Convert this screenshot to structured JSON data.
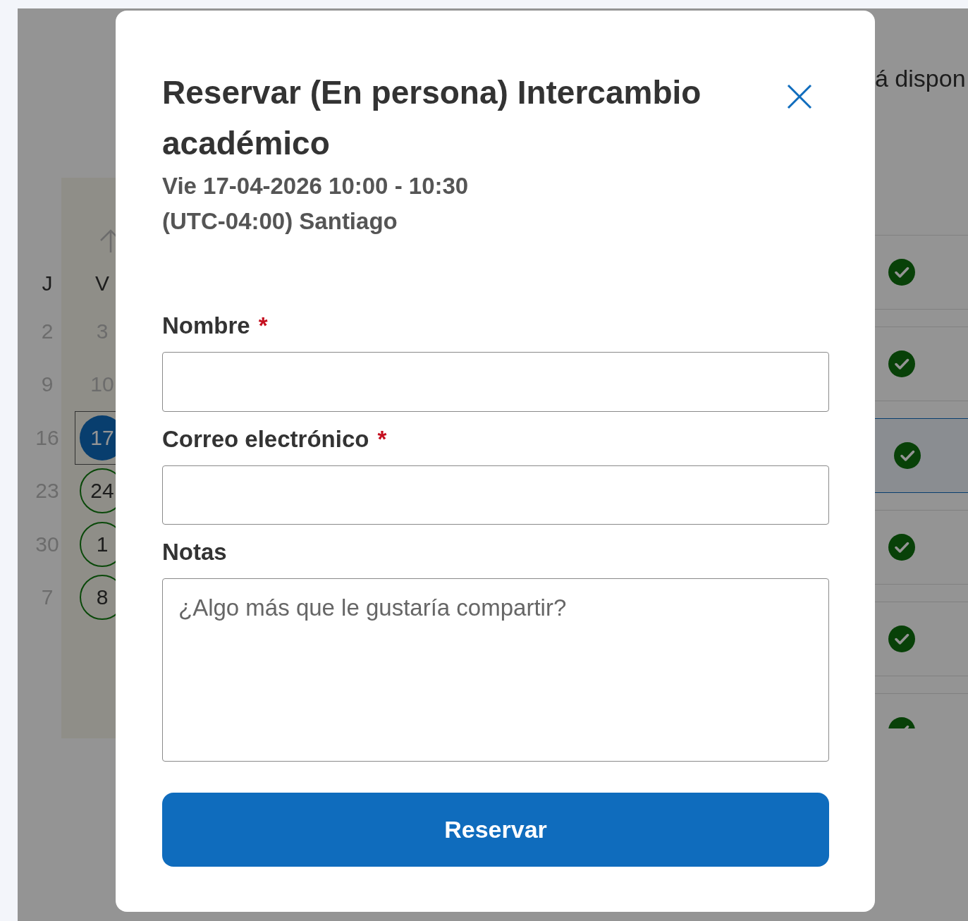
{
  "background": {
    "calendar": {
      "weekdays": [
        "J",
        "V"
      ],
      "weeks": [
        {
          "days": [
            {
              "label": "2",
              "kind": "unavailable",
              "selected": false
            },
            {
              "label": "3",
              "kind": "unavailable",
              "selected": false
            }
          ]
        },
        {
          "days": [
            {
              "label": "9",
              "kind": "unavailable",
              "selected": false
            },
            {
              "label": "10",
              "kind": "unavailable",
              "selected": false
            }
          ]
        },
        {
          "days": [
            {
              "label": "16",
              "kind": "unavailable",
              "selected": false
            },
            {
              "label": "17",
              "kind": "available",
              "selected": true
            }
          ]
        },
        {
          "days": [
            {
              "label": "23",
              "kind": "unavailable",
              "selected": false
            },
            {
              "label": "24",
              "kind": "available",
              "selected": false
            }
          ]
        },
        {
          "days": [
            {
              "label": "30",
              "kind": "unavailable",
              "selected": false
            },
            {
              "label": "1",
              "kind": "available",
              "selected": false
            }
          ]
        },
        {
          "days": [
            {
              "label": "7",
              "kind": "unavailable",
              "selected": false
            },
            {
              "label": "8",
              "kind": "available",
              "selected": false
            }
          ]
        }
      ]
    },
    "availability_text": "á dispon",
    "slots": [
      {
        "selected": false
      },
      {
        "selected": false
      },
      {
        "selected": true
      },
      {
        "selected": false
      },
      {
        "selected": false
      },
      {
        "selected": false
      }
    ]
  },
  "dialog": {
    "title": "Reservar (En persona) Intercambio académico",
    "date": "Vie 17-04-2026 10:00 - 10:30",
    "timezone": "(UTC-04:00) Santiago",
    "fields": [
      {
        "label": "Nombre",
        "required_mark": "*",
        "kind": "input"
      },
      {
        "label": "Correo electrónico",
        "required_mark": "*",
        "kind": "input"
      },
      {
        "label": "Notas",
        "kind": "textarea",
        "placeholder": "¿Algo más que le gustaría compartir?"
      }
    ],
    "submit": "Reservar"
  }
}
